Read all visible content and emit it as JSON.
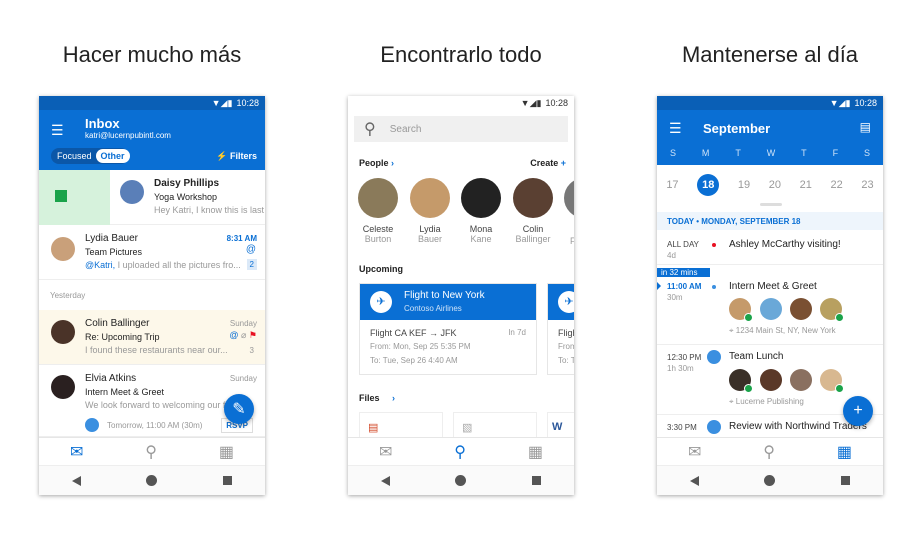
{
  "titles": [
    "Hacer mucho más",
    "Encontrarlo todo",
    "Mantenerse al día"
  ],
  "status_time": "10:28",
  "inbox": {
    "title": "Inbox",
    "account": "katri@lucernpubintl.com",
    "tab_focused": "Focused",
    "tab_other": "Other",
    "filters": "Filters",
    "section_yesterday": "Yesterday",
    "messages": [
      {
        "sender": "Daisy Phillips",
        "subject": "Yoga Workshop",
        "preview": "Hey Katri, I know this is last minute",
        "time": ""
      },
      {
        "sender": "Lydia Bauer",
        "subject": "Team Pictures",
        "mention": "@Katri,",
        "preview": " I uploaded all the pictures fro...",
        "time": "8:31 AM",
        "count": "2"
      },
      {
        "sender": "Colin Ballinger",
        "subject": "Re: Upcoming Trip",
        "preview": "I found these restaurants near our...",
        "time": "Sunday",
        "count": "3"
      },
      {
        "sender": "Elvia Atkins",
        "subject": "Intern Meet & Greet",
        "preview": "We look forward to welcoming our fall",
        "time": "Sunday",
        "event": "Tomorrow, 11:00 AM (30m)",
        "rsvp": "RSVP"
      }
    ]
  },
  "search": {
    "placeholder": "Search",
    "people_label": "People",
    "create_label": "Create",
    "people": [
      {
        "first": "Celeste",
        "last": "Burton"
      },
      {
        "first": "Lydia",
        "last": "Bauer"
      },
      {
        "first": "Mona",
        "last": "Kane"
      },
      {
        "first": "Colin",
        "last": "Ballinger"
      },
      {
        "first": "F",
        "last": ""
      }
    ],
    "upcoming_label": "Upcoming",
    "flight": {
      "title": "Flight to New York",
      "airline": "Contoso Airlines",
      "route": "Flight CA KEF → JFK",
      "in": "In 7d",
      "from": "From: Mon, Sep 25 5:35 PM",
      "to": "To: Tue, Sep 26 4:40 AM"
    },
    "flight2": {
      "route": "Fligh",
      "from": "From",
      "to": "To: T"
    },
    "files_label": "Files"
  },
  "calendar": {
    "month": "September",
    "weekdays": [
      "S",
      "M",
      "T",
      "W",
      "T",
      "F",
      "S"
    ],
    "dates": [
      "17",
      "18",
      "19",
      "20",
      "21",
      "22",
      "23"
    ],
    "today_header": "TODAY • MONDAY, SEPTEMBER 18",
    "allday_label": "ALL DAY",
    "allday_duration": "4d",
    "allday_title": "Ashley McCarthy visiting!",
    "countdown": "in 32 mins",
    "events": [
      {
        "time": "11:00 AM",
        "duration": "30m",
        "title": "Intern Meet & Greet",
        "location": "1234 Main St, NY, New York"
      },
      {
        "time": "12:30 PM",
        "duration": "1h 30m",
        "title": "Team Lunch",
        "location": "Lucerne Publishing"
      },
      {
        "time": "3:30 PM",
        "title": "Review with Northwind Traders"
      }
    ]
  },
  "colors": {
    "accent": "#0a6fd4",
    "archive": "#d6f2dc",
    "flag": "#e81123",
    "highlight": "#fdf8ea"
  }
}
